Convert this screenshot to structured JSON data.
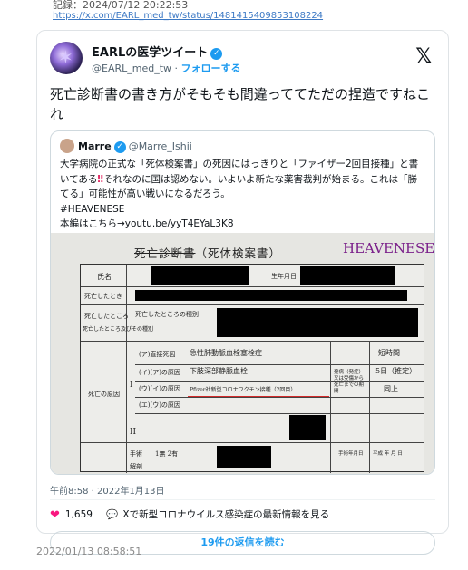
{
  "record": {
    "date": "記録：2024/07/12 20:22:53",
    "url": "https://x.com/EARL_med_tw/status/1481415409853108224"
  },
  "tweet": {
    "display_name": "EARLの医学ツイート",
    "handle": "@EARL_med_tw",
    "separator": "·",
    "follow_label": "フォローする",
    "text": "死亡診断書の書き方がそもそも間違っててただの捏造ですねこれ",
    "timestamp": "午前8:58 · 2022年1月13日",
    "likes": "1,659",
    "info_link": "Xで新型コロナウイルス感染症の最新情報を見る",
    "reply_button": "19件の返信を読む",
    "icons": {
      "verified": "verified-badge-icon",
      "x": "x-logo-icon",
      "heart": "heart-icon",
      "chat": "speech-bubble-icon"
    },
    "colors": {
      "accent": "#1d9bf0",
      "heart": "#f91880"
    }
  },
  "quote": {
    "display_name": "Marre",
    "handle": "@Marre_Ishii",
    "text_1": "大学病院の正式な「死体検案書」の死因にはっきりと「ファイザー2回目接種」と書いてある",
    "bang": "‼",
    "text_2": "それなのに国は認めない。いよいよ新たな薬害裁判が始まる。これは「勝てる」可能性が高い戦いになるだろう。",
    "hashtag": "#HEAVENESE",
    "link_line": "本編はこちら→youtu.be/yyT4EYaL3K8",
    "document": {
      "title_struck": "死亡診断書",
      "title_rest": "（死体検案書）",
      "brand": "HEAVENESE",
      "labels": {
        "name": "氏名",
        "birth": "生年月日",
        "death_time": "死亡したとき",
        "death_place": "死亡したところ",
        "death_place2": "死亡したところ及びその種別",
        "place_line": "死亡したところの種別",
        "cause": "死亡の原因",
        "interval": "発病（発症）又は受傷から死亡までの期間",
        "a": "(ア)直接死因",
        "b": "(イ)(ア)の原因",
        "c": "(ウ)(イ)の原因",
        "d": "(エ)(ウ)の原因",
        "roman1": "I",
        "roman2": "II",
        "surgery": "手術",
        "autopsy": "解剖",
        "none": "1無 2有",
        "op_date": "手術年月日",
        "year_month": "平成 年 月 日"
      },
      "causes": {
        "a": "急性肺動脈血栓塞栓症",
        "b": "下肢深部静脈血栓",
        "c": "Pfizer社新型コロナワクチン接種（2回目）"
      },
      "durations": {
        "a": "短時間",
        "b": "5日（推定）",
        "c": "同上"
      }
    }
  },
  "footer": {
    "date": "2022/01/13 08:58:51"
  }
}
